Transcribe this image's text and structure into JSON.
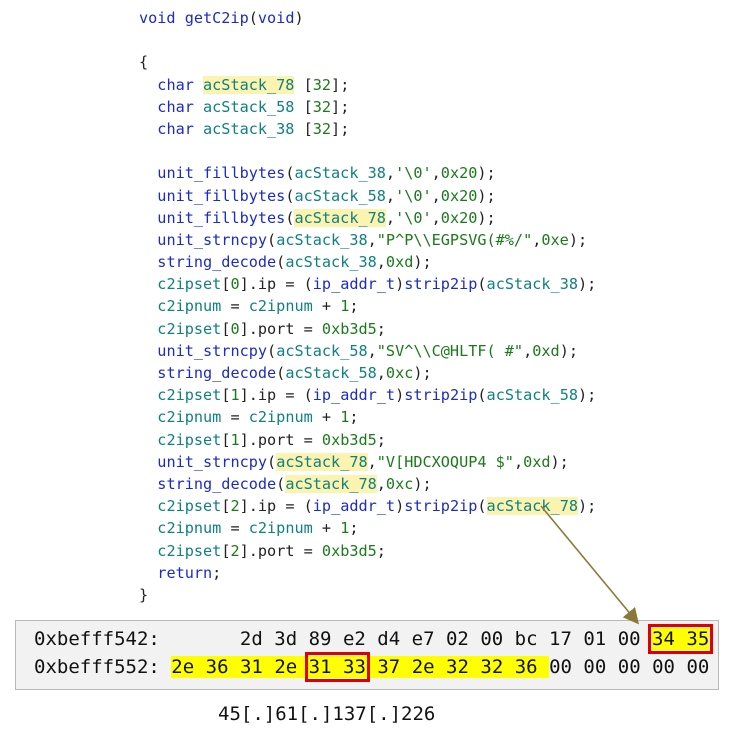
{
  "code": {
    "lines": [
      [
        {
          "t": "void ",
          "c": "kw"
        },
        {
          "t": "getC2ip",
          "c": "fn"
        },
        {
          "t": "(",
          "c": "pl"
        },
        {
          "t": "void",
          "c": "kw"
        },
        {
          "t": ")",
          "c": "pl"
        }
      ],
      [],
      [
        {
          "t": "{",
          "c": "pl"
        }
      ],
      [
        {
          "t": "  ",
          "c": "pl"
        },
        {
          "t": "char ",
          "c": "ty"
        },
        {
          "t": "acStack_78",
          "c": "var",
          "hl": true
        },
        {
          "t": " [",
          "c": "pl"
        },
        {
          "t": "32",
          "c": "num"
        },
        {
          "t": "];",
          "c": "pl"
        }
      ],
      [
        {
          "t": "  ",
          "c": "pl"
        },
        {
          "t": "char ",
          "c": "ty"
        },
        {
          "t": "acStack_58",
          "c": "var"
        },
        {
          "t": " [",
          "c": "pl"
        },
        {
          "t": "32",
          "c": "num"
        },
        {
          "t": "];",
          "c": "pl"
        }
      ],
      [
        {
          "t": "  ",
          "c": "pl"
        },
        {
          "t": "char ",
          "c": "ty"
        },
        {
          "t": "acStack_38",
          "c": "var"
        },
        {
          "t": " [",
          "c": "pl"
        },
        {
          "t": "32",
          "c": "num"
        },
        {
          "t": "];",
          "c": "pl"
        }
      ],
      [],
      [
        {
          "t": "  ",
          "c": "pl"
        },
        {
          "t": "unit_fillbytes",
          "c": "fn"
        },
        {
          "t": "(",
          "c": "pl"
        },
        {
          "t": "acStack_38",
          "c": "var"
        },
        {
          "t": ",",
          "c": "pl"
        },
        {
          "t": "'\\0'",
          "c": "str"
        },
        {
          "t": ",",
          "c": "pl"
        },
        {
          "t": "0x20",
          "c": "num"
        },
        {
          "t": ");",
          "c": "pl"
        }
      ],
      [
        {
          "t": "  ",
          "c": "pl"
        },
        {
          "t": "unit_fillbytes",
          "c": "fn"
        },
        {
          "t": "(",
          "c": "pl"
        },
        {
          "t": "acStack_58",
          "c": "var"
        },
        {
          "t": ",",
          "c": "pl"
        },
        {
          "t": "'\\0'",
          "c": "str"
        },
        {
          "t": ",",
          "c": "pl"
        },
        {
          "t": "0x20",
          "c": "num"
        },
        {
          "t": ");",
          "c": "pl"
        }
      ],
      [
        {
          "t": "  ",
          "c": "pl"
        },
        {
          "t": "unit_fillbytes",
          "c": "fn"
        },
        {
          "t": "(",
          "c": "pl"
        },
        {
          "t": "acStack_78",
          "c": "var",
          "hl": true
        },
        {
          "t": ",",
          "c": "pl"
        },
        {
          "t": "'\\0'",
          "c": "str"
        },
        {
          "t": ",",
          "c": "pl"
        },
        {
          "t": "0x20",
          "c": "num"
        },
        {
          "t": ");",
          "c": "pl"
        }
      ],
      [
        {
          "t": "  ",
          "c": "pl"
        },
        {
          "t": "unit_strncpy",
          "c": "fn"
        },
        {
          "t": "(",
          "c": "pl"
        },
        {
          "t": "acStack_38",
          "c": "var"
        },
        {
          "t": ",",
          "c": "pl"
        },
        {
          "t": "\"P^P\\\\EGPSVG(#%/\"",
          "c": "str"
        },
        {
          "t": ",",
          "c": "pl"
        },
        {
          "t": "0xe",
          "c": "num"
        },
        {
          "t": ");",
          "c": "pl"
        }
      ],
      [
        {
          "t": "  ",
          "c": "pl"
        },
        {
          "t": "string_decode",
          "c": "fn"
        },
        {
          "t": "(",
          "c": "pl"
        },
        {
          "t": "acStack_38",
          "c": "var"
        },
        {
          "t": ",",
          "c": "pl"
        },
        {
          "t": "0xd",
          "c": "num"
        },
        {
          "t": ");",
          "c": "pl"
        }
      ],
      [
        {
          "t": "  ",
          "c": "pl"
        },
        {
          "t": "c2ipset",
          "c": "var"
        },
        {
          "t": "[",
          "c": "pl"
        },
        {
          "t": "0",
          "c": "num"
        },
        {
          "t": "].ip = (",
          "c": "pl"
        },
        {
          "t": "ip_addr_t",
          "c": "ty"
        },
        {
          "t": ")",
          "c": "pl"
        },
        {
          "t": "strip2ip",
          "c": "fn"
        },
        {
          "t": "(",
          "c": "pl"
        },
        {
          "t": "acStack_38",
          "c": "var"
        },
        {
          "t": ");",
          "c": "pl"
        }
      ],
      [
        {
          "t": "  ",
          "c": "pl"
        },
        {
          "t": "c2ipnum",
          "c": "var"
        },
        {
          "t": " = ",
          "c": "pl"
        },
        {
          "t": "c2ipnum",
          "c": "var"
        },
        {
          "t": " + ",
          "c": "pl"
        },
        {
          "t": "1",
          "c": "num"
        },
        {
          "t": ";",
          "c": "pl"
        }
      ],
      [
        {
          "t": "  ",
          "c": "pl"
        },
        {
          "t": "c2ipset",
          "c": "var"
        },
        {
          "t": "[",
          "c": "pl"
        },
        {
          "t": "0",
          "c": "num"
        },
        {
          "t": "].port = ",
          "c": "pl"
        },
        {
          "t": "0xb3d5",
          "c": "num"
        },
        {
          "t": ";",
          "c": "pl"
        }
      ],
      [
        {
          "t": "  ",
          "c": "pl"
        },
        {
          "t": "unit_strncpy",
          "c": "fn"
        },
        {
          "t": "(",
          "c": "pl"
        },
        {
          "t": "acStack_58",
          "c": "var"
        },
        {
          "t": ",",
          "c": "pl"
        },
        {
          "t": "\"SV^\\\\C@HLTF( #\"",
          "c": "str"
        },
        {
          "t": ",",
          "c": "pl"
        },
        {
          "t": "0xd",
          "c": "num"
        },
        {
          "t": ");",
          "c": "pl"
        }
      ],
      [
        {
          "t": "  ",
          "c": "pl"
        },
        {
          "t": "string_decode",
          "c": "fn"
        },
        {
          "t": "(",
          "c": "pl"
        },
        {
          "t": "acStack_58",
          "c": "var"
        },
        {
          "t": ",",
          "c": "pl"
        },
        {
          "t": "0xc",
          "c": "num"
        },
        {
          "t": ");",
          "c": "pl"
        }
      ],
      [
        {
          "t": "  ",
          "c": "pl"
        },
        {
          "t": "c2ipset",
          "c": "var"
        },
        {
          "t": "[",
          "c": "pl"
        },
        {
          "t": "1",
          "c": "num"
        },
        {
          "t": "].ip = (",
          "c": "pl"
        },
        {
          "t": "ip_addr_t",
          "c": "ty"
        },
        {
          "t": ")",
          "c": "pl"
        },
        {
          "t": "strip2ip",
          "c": "fn"
        },
        {
          "t": "(",
          "c": "pl"
        },
        {
          "t": "acStack_58",
          "c": "var"
        },
        {
          "t": ");",
          "c": "pl"
        }
      ],
      [
        {
          "t": "  ",
          "c": "pl"
        },
        {
          "t": "c2ipnum",
          "c": "var"
        },
        {
          "t": " = ",
          "c": "pl"
        },
        {
          "t": "c2ipnum",
          "c": "var"
        },
        {
          "t": " + ",
          "c": "pl"
        },
        {
          "t": "1",
          "c": "num"
        },
        {
          "t": ";",
          "c": "pl"
        }
      ],
      [
        {
          "t": "  ",
          "c": "pl"
        },
        {
          "t": "c2ipset",
          "c": "var"
        },
        {
          "t": "[",
          "c": "pl"
        },
        {
          "t": "1",
          "c": "num"
        },
        {
          "t": "].port = ",
          "c": "pl"
        },
        {
          "t": "0xb3d5",
          "c": "num"
        },
        {
          "t": ";",
          "c": "pl"
        }
      ],
      [
        {
          "t": "  ",
          "c": "pl"
        },
        {
          "t": "unit_strncpy",
          "c": "fn"
        },
        {
          "t": "(",
          "c": "pl"
        },
        {
          "t": "acStack_78",
          "c": "var",
          "hl": true
        },
        {
          "t": ",",
          "c": "pl"
        },
        {
          "t": "\"V[HDCXOQUP4 $\"",
          "c": "str"
        },
        {
          "t": ",",
          "c": "pl"
        },
        {
          "t": "0xd",
          "c": "num"
        },
        {
          "t": ");",
          "c": "pl"
        }
      ],
      [
        {
          "t": "  ",
          "c": "pl"
        },
        {
          "t": "string_decode",
          "c": "fn"
        },
        {
          "t": "(",
          "c": "pl"
        },
        {
          "t": "acStack_78",
          "c": "var",
          "hl": true
        },
        {
          "t": ",",
          "c": "pl"
        },
        {
          "t": "0xc",
          "c": "num"
        },
        {
          "t": ");",
          "c": "pl"
        }
      ],
      [
        {
          "t": "  ",
          "c": "pl"
        },
        {
          "t": "c2ipset",
          "c": "var"
        },
        {
          "t": "[",
          "c": "pl"
        },
        {
          "t": "2",
          "c": "num"
        },
        {
          "t": "].ip = (",
          "c": "pl"
        },
        {
          "t": "ip_addr_t",
          "c": "ty"
        },
        {
          "t": ")",
          "c": "pl"
        },
        {
          "t": "strip2ip",
          "c": "fn"
        },
        {
          "t": "(",
          "c": "pl"
        },
        {
          "t": "acStack_78",
          "c": "var",
          "hl": true
        },
        {
          "t": ");",
          "c": "pl"
        }
      ],
      [
        {
          "t": "  ",
          "c": "pl"
        },
        {
          "t": "c2ipnum",
          "c": "var"
        },
        {
          "t": " = ",
          "c": "pl"
        },
        {
          "t": "c2ipnum",
          "c": "var"
        },
        {
          "t": " + ",
          "c": "pl"
        },
        {
          "t": "1",
          "c": "num"
        },
        {
          "t": ";",
          "c": "pl"
        }
      ],
      [
        {
          "t": "  ",
          "c": "pl"
        },
        {
          "t": "c2ipset",
          "c": "var"
        },
        {
          "t": "[",
          "c": "pl"
        },
        {
          "t": "2",
          "c": "num"
        },
        {
          "t": "].port = ",
          "c": "pl"
        },
        {
          "t": "0xb3d5",
          "c": "num"
        },
        {
          "t": ";",
          "c": "pl"
        }
      ],
      [
        {
          "t": "  ",
          "c": "pl"
        },
        {
          "t": "return",
          "c": "kw"
        },
        {
          "t": ";",
          "c": "pl"
        }
      ],
      [
        {
          "t": "}",
          "c": "pl"
        }
      ]
    ]
  },
  "memory": {
    "rows": [
      {
        "address": "0xbefff542:",
        "gap": "       ",
        "bytes": [
          {
            "v": "2d"
          },
          {
            "v": "3d"
          },
          {
            "v": "89"
          },
          {
            "v": "e2"
          },
          {
            "v": "d4"
          },
          {
            "v": "e7"
          },
          {
            "v": "02"
          },
          {
            "v": "00"
          },
          {
            "v": "bc"
          },
          {
            "v": "17"
          },
          {
            "v": "01"
          },
          {
            "v": "00"
          },
          {
            "v": "34",
            "hl": true,
            "box": "start"
          },
          {
            "v": "35",
            "hl": true,
            "box": "end"
          }
        ]
      },
      {
        "address": "0xbefff552:",
        "gap": " ",
        "bytes": [
          {
            "v": "2e",
            "hl": true
          },
          {
            "v": "36",
            "hl": true
          },
          {
            "v": "31",
            "hl": true
          },
          {
            "v": "2e",
            "hl": true
          },
          {
            "v": "31",
            "hl": true,
            "box": "start"
          },
          {
            "v": "33",
            "hl": true,
            "box": "end"
          },
          {
            "v": "37",
            "hl": true
          },
          {
            "v": "2e",
            "hl": true
          },
          {
            "v": "32",
            "hl": true
          },
          {
            "v": "32",
            "hl": true
          },
          {
            "v": "36",
            "hl": true
          },
          {
            "v": "00"
          },
          {
            "v": "00"
          },
          {
            "v": "00"
          },
          {
            "v": "00"
          },
          {
            "v": "00"
          }
        ]
      }
    ]
  },
  "caption": "45[.]61[.]137[.]226",
  "colors": {
    "keyword": "#1c2bc8",
    "variable": "#108080",
    "number": "#1a7a1a",
    "highlight": "#fbf3b0",
    "byte_highlight": "#ffff00",
    "box": "#e00000",
    "arrow": "#8a7a3a"
  }
}
